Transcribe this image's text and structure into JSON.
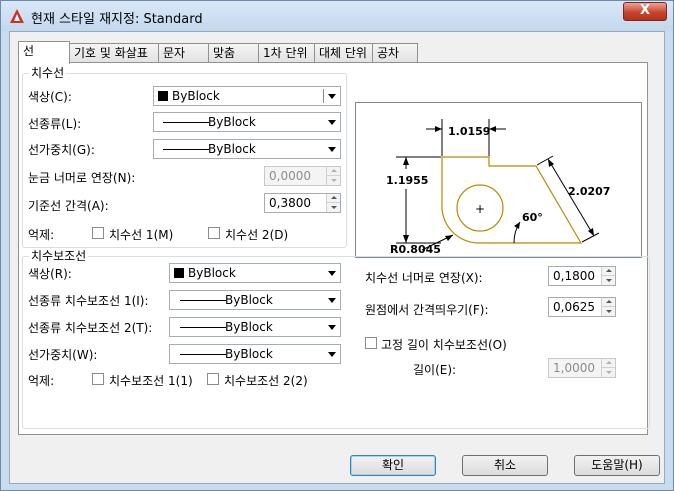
{
  "window": {
    "title": "현재 스타일 재지정: Standard",
    "close_label": "X"
  },
  "tabs": [
    "선",
    "기호 및 화살표",
    "문자",
    "맞춤",
    "1차 단위",
    "대체 단위",
    "공차"
  ],
  "dim_line_group": {
    "title": "치수선",
    "color_label": "색상(C):",
    "color_value": "ByBlock",
    "linetype_label": "선종류(L):",
    "linetype_value": "ByBlock",
    "lineweight_label": "선가중치(G):",
    "lineweight_value": "ByBlock",
    "extend_ticks_label": "눈금 너머로 연장(N):",
    "extend_ticks_value": "0,0000",
    "baseline_spacing_label": "기준선 간격(A):",
    "baseline_spacing_value": "0,3800",
    "suppress_label": "억제:",
    "suppress_1_label": "치수선 1(M)",
    "suppress_2_label": "치수선 2(D)"
  },
  "ext_line_group": {
    "title": "치수보조선",
    "color_label": "색상(R):",
    "color_value": "ByBlock",
    "linetype1_label": "선종류 치수보조선 1(I):",
    "linetype1_value": "ByBlock",
    "linetype2_label": "선종류 치수보조선 2(T):",
    "linetype2_value": "ByBlock",
    "lineweight_label": "선가중치(W):",
    "lineweight_value": "ByBlock",
    "suppress_label": "억제:",
    "suppress_1_label": "치수보조선 1(1)",
    "suppress_2_label": "치수보조선 2(2)",
    "extend_beyond_label": "치수선 너머로 연장(X):",
    "extend_beyond_value": "0,1800",
    "offset_label": "원점에서 간격띄우기(F):",
    "offset_value": "0,0625",
    "fixed_length_label": "고정 길이 치수보조선(O)",
    "length_label": "길이(E):",
    "length_value": "1,0000"
  },
  "preview": {
    "dim_top": "1.0159",
    "dim_left": "1.1955",
    "dim_right": "2.0207",
    "angle": "60°",
    "radius": "R0.8045",
    "center_mark": "+",
    "geometry_color": "#b58a00"
  },
  "buttons": {
    "ok": "확인",
    "cancel": "취소",
    "help": "도움말(H)"
  },
  "colors": {
    "close_button": "#c7452c",
    "app_icon": "#d62d20",
    "frame": "#c9dcef"
  }
}
